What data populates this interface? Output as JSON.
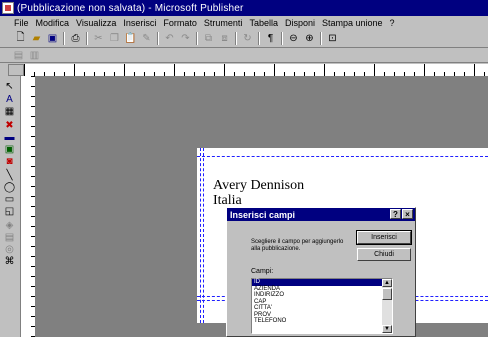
{
  "window": {
    "title": "(Pubblicazione non salvata) - Microsoft Publisher"
  },
  "menu": [
    "File",
    "Modifica",
    "Visualizza",
    "Inserisci",
    "Formato",
    "Strumenti",
    "Tabella",
    "Disponi",
    "Stampa unione",
    "?"
  ],
  "toolbar": {
    "icons": [
      "new-icon",
      "open-icon",
      "save-icon",
      "print-icon",
      "cut-icon",
      "copy-icon",
      "paste-icon",
      "format-painter-icon",
      "undo-icon",
      "redo-icon",
      "bring-front-icon",
      "send-back-icon",
      "rotate-icon",
      "show-special-chars-icon",
      "zoom-out-icon",
      "zoom-in-icon",
      "wizard-icon"
    ]
  },
  "document": {
    "line1": "Avery Dennison",
    "line2": "Italia"
  },
  "dialog": {
    "title": "Inserisci campi",
    "help_label": "?",
    "close_label": "×",
    "description": "Scegliere il campo per aggiungerlo alla pubblicazione.",
    "insert_button": "Inserisci",
    "close_button": "Chiudi",
    "fields_label": "Campi:",
    "fields": [
      "ID",
      "AZIENDA",
      "INDIRIZZO",
      "CAP",
      "CITTA'",
      "PROV",
      "TELEFONO"
    ],
    "selected_field": "ID"
  }
}
